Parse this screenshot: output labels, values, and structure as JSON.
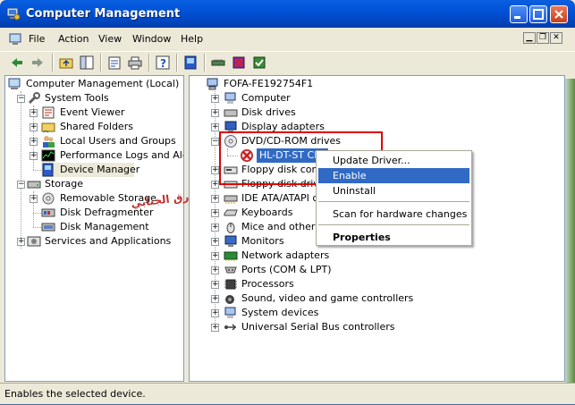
{
  "window": {
    "title": "Computer Management",
    "status_text": "Enables the selected device."
  },
  "menu": {
    "items": [
      "File",
      "Action",
      "View",
      "Window",
      "Help"
    ]
  },
  "toolbar": {
    "buttons": [
      "back-icon",
      "forward-icon",
      "up-folder-icon",
      "show-tree-icon",
      "properties-icon",
      "print-icon",
      "help-icon",
      "device-manager-icon",
      "scan-hardware-icon",
      "disable-device-icon",
      "update-driver-icon"
    ]
  },
  "left_tree": {
    "root": "Computer Management (Local)",
    "system_tools": "System Tools",
    "system_tools_children": [
      "Event Viewer",
      "Shared Folders",
      "Local Users and Groups",
      "Performance Logs and Alerts",
      "Device Manager"
    ],
    "storage": "Storage",
    "storage_children": [
      "Removable Storage",
      "Disk Defragmenter",
      "Disk Management"
    ],
    "services": "Services and Applications"
  },
  "right_tree": {
    "root": "FOFA-FE192754F1",
    "items": [
      "Computer",
      "Disk drives",
      "Display adapters",
      "DVD/CD-ROM drives",
      "HL-DT-ST CD-",
      "Floppy disk contro",
      "Floppy disk drives",
      "IDE ATA/ATAPI c",
      "Keyboards",
      "Mice and other po",
      "Monitors",
      "Network adapters",
      "Ports (COM & LPT)",
      "Processors",
      "Sound, video and game controllers",
      "System devices",
      "Universal Serial Bus controllers"
    ]
  },
  "context_menu": {
    "update_driver": "Update Driver...",
    "enable": "Enable",
    "uninstall": "Uninstall",
    "scan": "Scan for hardware changes",
    "properties": "Properties"
  },
  "watermark": "اجراءت طارق الجنابي",
  "colors": {
    "title_blue": "#0052d6",
    "selection": "#316ac5",
    "highlight_box": "#e00000"
  }
}
